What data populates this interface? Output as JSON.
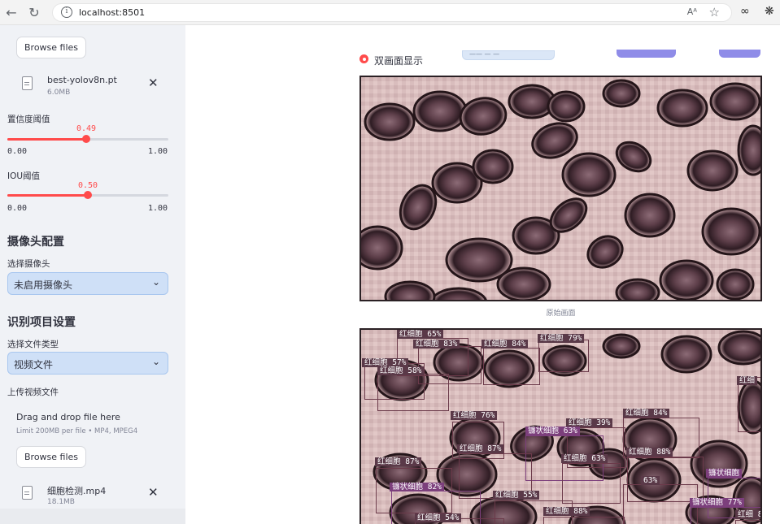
{
  "browser": {
    "url": "localhost:8501",
    "reader_label": "Aᴬ"
  },
  "sidebar": {
    "browse_label": "Browse files",
    "model_file": {
      "name": "best-yolov8n.pt",
      "size": "6.0MB"
    },
    "confidence": {
      "label": "置信度阈值",
      "value": "0.49",
      "fraction": 0.49,
      "min": "0.00",
      "max": "1.00"
    },
    "iou": {
      "label": "IOU阈值",
      "value": "0.50",
      "fraction": 0.5,
      "min": "0.00",
      "max": "1.00"
    },
    "camera_heading": "摄像头配置",
    "camera_select_label": "选择摄像头",
    "camera_select_value": "未启用摄像头",
    "recognition_heading": "识别项目设置",
    "file_type_label": "选择文件类型",
    "file_type_value": "视频文件",
    "upload_label": "上传视频文件",
    "dropzone_title": "Drag and drop file here",
    "dropzone_sub": "Limit 200MB per file • MP4, MPEG4",
    "video_file": {
      "name": "细胞检测.mp4",
      "size": "18.1MB"
    }
  },
  "main": {
    "radio_label": "双画面显示",
    "partial_top_text": "—— — —",
    "original_caption": "原始画面",
    "detections": [
      {
        "label": "红细胞 65%",
        "kind": "rbc"
      },
      {
        "label": "红细胞 83%",
        "kind": "rbc"
      },
      {
        "label": "红细胞 84%",
        "kind": "rbc"
      },
      {
        "label": "红细胞 79%",
        "kind": "rbc"
      },
      {
        "label": "红细胞 57%",
        "kind": "rbc"
      },
      {
        "label": "红细胞 58%",
        "kind": "rbc"
      },
      {
        "label": "红细",
        "kind": "rbc"
      },
      {
        "label": "红细胞 76%",
        "kind": "rbc"
      },
      {
        "label": "红细胞 39%",
        "kind": "rbc"
      },
      {
        "label": "红细胞 84%",
        "kind": "rbc"
      },
      {
        "label": "镰状细胞 63%",
        "kind": "sickle"
      },
      {
        "label": "红细胞 87%",
        "kind": "rbc"
      },
      {
        "label": "红细胞 88%",
        "kind": "rbc"
      },
      {
        "label": "红细胞 63%",
        "kind": "rbc"
      },
      {
        "label": "红细胞 87%",
        "kind": "rbc"
      },
      {
        "label": "镰状细胞",
        "kind": "sickle"
      },
      {
        "label": "63%",
        "kind": "rbc"
      },
      {
        "label": "镰状细胞 82%",
        "kind": "sickle"
      },
      {
        "label": "红细胞 55%",
        "kind": "rbc"
      },
      {
        "label": "镰状细胞 77%",
        "kind": "sickle"
      },
      {
        "label": "红细胞 54%",
        "kind": "rbc"
      },
      {
        "label": "红细胞 88%",
        "kind": "rbc"
      },
      {
        "label": "红细 8",
        "kind": "rbc"
      }
    ]
  },
  "colors": {
    "accent": "#ff4b4b",
    "select_bg": "#cfe0f7",
    "sidebar_bg": "#f0f2f6",
    "pill": "#8f8ce8"
  }
}
